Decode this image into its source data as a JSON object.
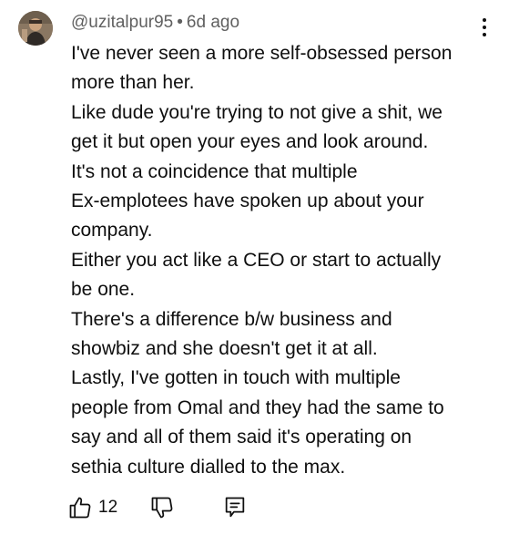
{
  "comment": {
    "author": "@uzitalpur95",
    "separator": "•",
    "timestamp": "6d ago",
    "body_lines": [
      "I've never seen a more self-obsessed person",
      "more than her.",
      "Like dude you're trying to not give a shit, we",
      "get it but open your eyes and look around.",
      "It's not a coincidence that multiple",
      "Ex-emplotees have spoken up about your",
      "company.",
      "Either you act like a CEO or start to actually",
      "be one.",
      "There's a difference b/w business and",
      "showbiz and she doesn't get it at all.",
      "Lastly, I've gotten in touch with multiple",
      "people from Omal and they had the same to",
      "say and all of them said it's operating on",
      "sethia culture dialled to the max."
    ],
    "like_count": "12"
  },
  "icons": {
    "avatar": "avatar-photo",
    "menu": "more-vertical-icon",
    "like": "thumbs-up-icon",
    "dislike": "thumbs-down-icon",
    "reply": "reply-comment-icon"
  },
  "colors": {
    "text": "#0f0f0f",
    "meta": "#606060",
    "background": "#ffffff"
  }
}
